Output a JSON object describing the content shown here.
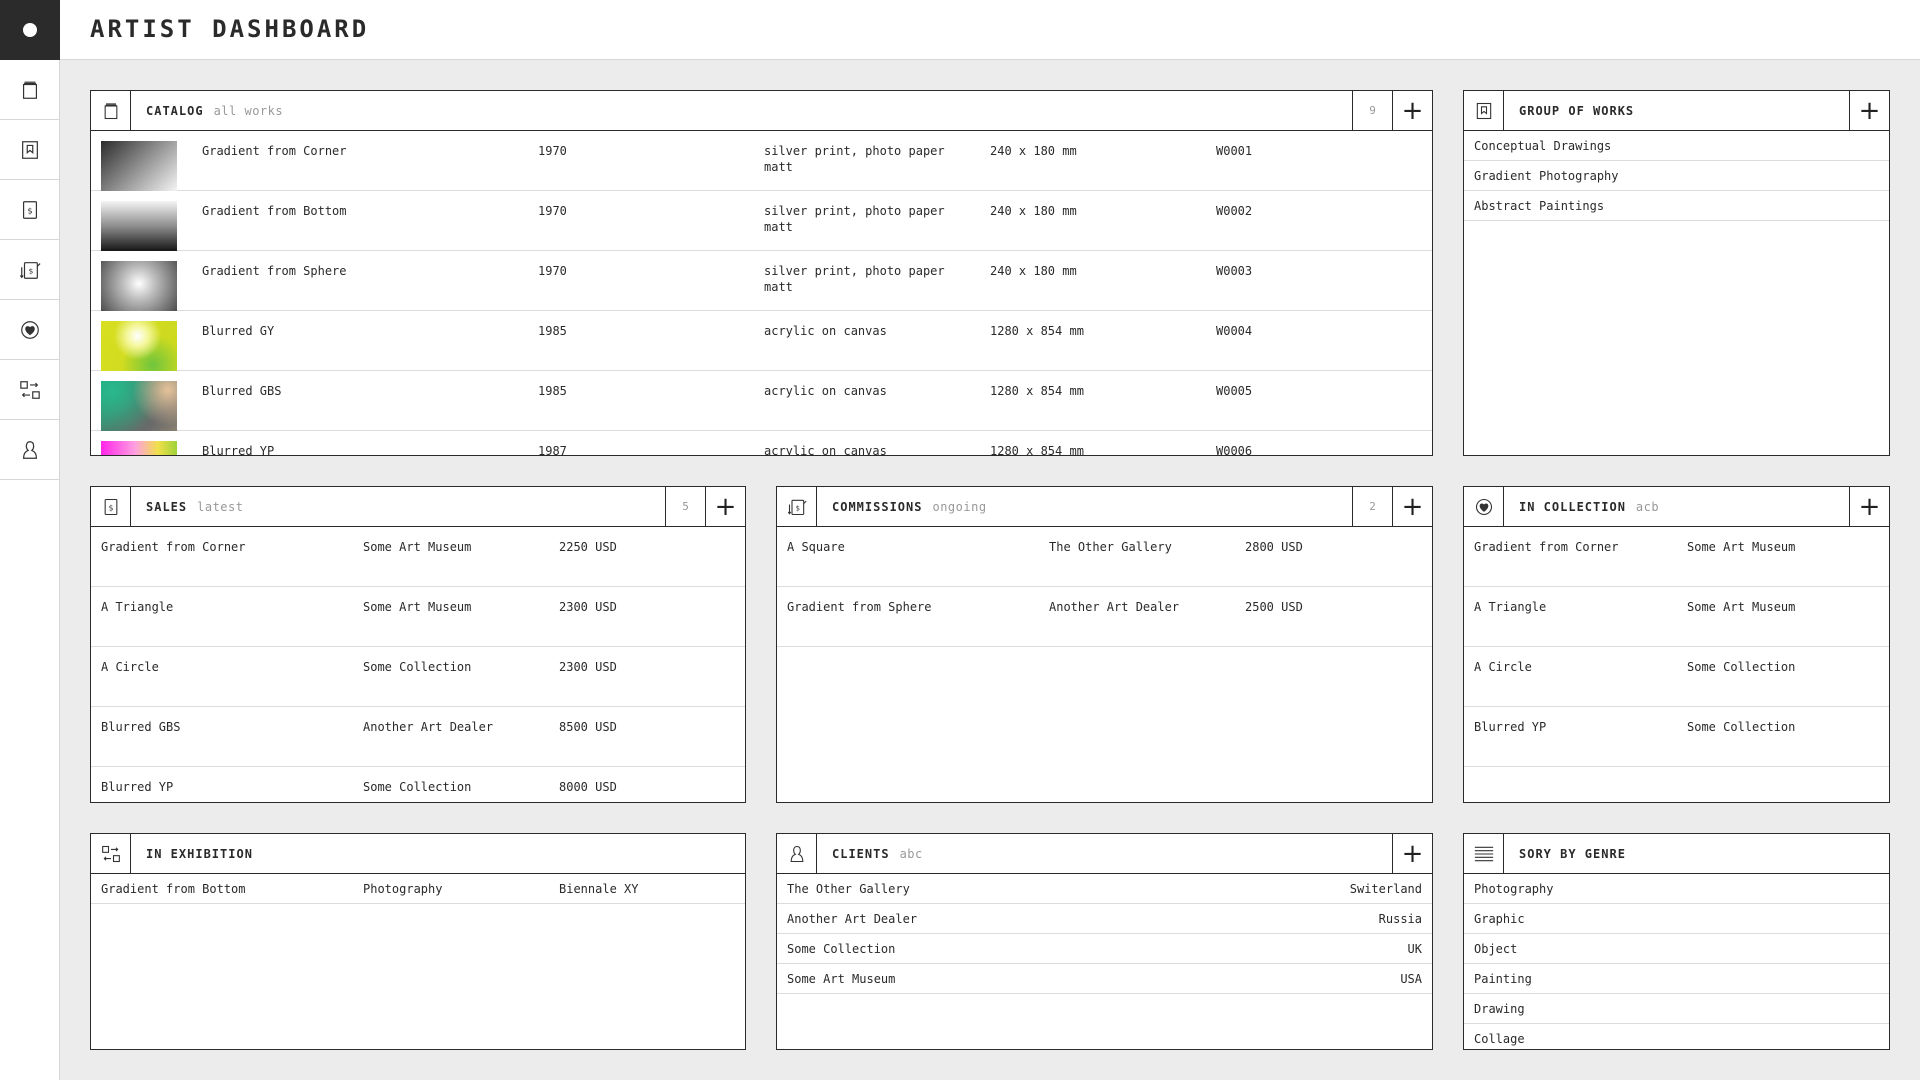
{
  "app": {
    "title": "ARTIST DASHBOARD"
  },
  "catalog": {
    "title": "CATALOG",
    "subtitle": "all works",
    "count": "9",
    "rows": [
      {
        "thumb": "gradient-corner",
        "title": "Gradient from Corner",
        "year": "1970",
        "medium": "silver print, photo paper matt",
        "size": "240 x 180 mm",
        "id": "W0001"
      },
      {
        "thumb": "gradient-bottom",
        "title": "Gradient from Bottom",
        "year": "1970",
        "medium": "silver print, photo paper matt",
        "size": "240 x 180 mm",
        "id": "W0002"
      },
      {
        "thumb": "gradient-sphere",
        "title": "Gradient from Sphere",
        "year": "1970",
        "medium": "silver print, photo paper matt",
        "size": "240 x 180 mm",
        "id": "W0003"
      },
      {
        "thumb": "blurred-gy",
        "title": "Blurred GY",
        "year": "1985",
        "medium": "acrylic on canvas",
        "size": "1280 x 854 mm",
        "id": "W0004"
      },
      {
        "thumb": "blurred-gbs",
        "title": "Blurred GBS",
        "year": "1985",
        "medium": "acrylic on canvas",
        "size": "1280 x 854 mm",
        "id": "W0005"
      },
      {
        "thumb": "blurred-yp",
        "title": "Blurred YP",
        "year": "1987",
        "medium": "acrylic on canvas",
        "size": "1280 x 854 mm",
        "id": "W0006"
      }
    ]
  },
  "groups": {
    "title": "GROUP OF WORKS",
    "items": [
      "Conceptual Drawings",
      "Gradient Photography",
      "Abstract Paintings"
    ]
  },
  "sales": {
    "title": "SALES",
    "subtitle": "latest",
    "count": "5",
    "rows": [
      {
        "work": "Gradient from Corner",
        "buyer": "Some Art Museum",
        "price": "2250 USD"
      },
      {
        "work": "A Triangle",
        "buyer": "Some Art Museum",
        "price": "2300 USD"
      },
      {
        "work": "A Circle",
        "buyer": "Some Collection",
        "price": "2300 USD"
      },
      {
        "work": "Blurred GBS",
        "buyer": "Another Art Dealer",
        "price": "8500 USD"
      },
      {
        "work": "Blurred YP",
        "buyer": "Some Collection",
        "price": "8000 USD"
      }
    ]
  },
  "commissions": {
    "title": "COMMISSIONS",
    "subtitle": "ongoing",
    "count": "2",
    "rows": [
      {
        "work": "A Square",
        "client": "The Other Gallery",
        "price": "2800 USD"
      },
      {
        "work": "Gradient from Sphere",
        "client": "Another Art Dealer",
        "price": "2500 USD"
      }
    ]
  },
  "in_collection": {
    "title": "IN COLLECTION",
    "subtitle": "acb",
    "rows": [
      {
        "work": "Gradient from Corner",
        "owner": "Some Art Museum"
      },
      {
        "work": "A Triangle",
        "owner": "Some Art Museum"
      },
      {
        "work": "A Circle",
        "owner": "Some Collection"
      },
      {
        "work": "Blurred YP",
        "owner": "Some Collection"
      }
    ]
  },
  "in_exhibition": {
    "title": "IN EXHIBITION",
    "rows": [
      {
        "work": "Gradient from Bottom",
        "category": "Photography",
        "event": "Biennale XY"
      }
    ]
  },
  "clients": {
    "title": "CLIENTS",
    "subtitle": "abc",
    "rows": [
      {
        "name": "The Other Gallery",
        "country": "Switerland"
      },
      {
        "name": "Another Art Dealer",
        "country": "Russia"
      },
      {
        "name": "Some Collection",
        "country": "UK"
      },
      {
        "name": "Some Art Museum",
        "country": "USA"
      }
    ]
  },
  "genres": {
    "title": "SORY BY GENRE",
    "items": [
      "Photography",
      "Graphic",
      "Object",
      "Painting",
      "Drawing",
      "Collage"
    ]
  },
  "icons": {
    "sidebar": [
      "logo-dot-icon",
      "catalog-icon",
      "bookmark-icon",
      "dollar-icon",
      "exchange-dollar-icon",
      "heart-icon",
      "exhibition-icon",
      "person-icon"
    ]
  }
}
